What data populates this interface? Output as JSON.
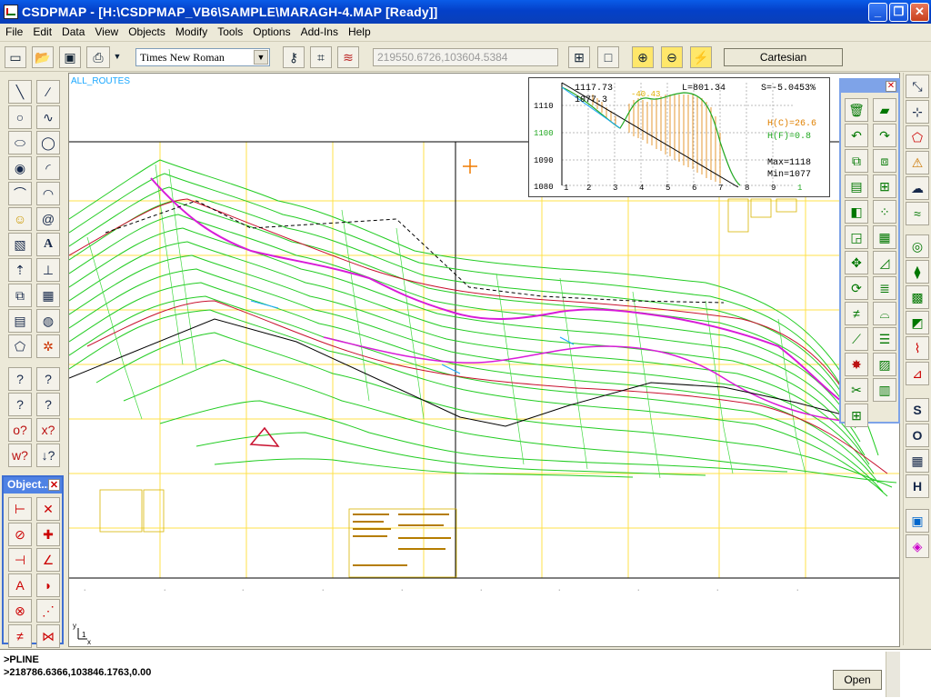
{
  "window": {
    "title": "CSDPMAP - [H:\\CSDPMAP_VB6\\SAMPLE\\MARAGH-4.MAP [Ready]]",
    "minimize": "_",
    "restore": "❐",
    "close": "✕"
  },
  "menu": [
    "File",
    "Edit",
    "Data",
    "View",
    "Objects",
    "Modify",
    "Tools",
    "Options",
    "Add-Ins",
    "Help"
  ],
  "toolbar": {
    "font_name": "Times New Roman",
    "coordinates": "219550.6726,103604.5384",
    "mode": "Cartesian"
  },
  "object_panel": {
    "title": "Object...",
    "close": "✕"
  },
  "canvas": {
    "layer_label": "ALL_ROUTES"
  },
  "profile": {
    "left_top_value": "1117.73",
    "left_second_value": "1077.3",
    "length_label": "L=801.34",
    "slope_label": "S=-5.0453%",
    "peak_label": "-40.43",
    "hc_label": "H(C)=26.6",
    "hf_label": "H(F)=0.8",
    "max_label": "Max=1118",
    "min_label": "Min=1077",
    "y_ticks": [
      "1110",
      "1100",
      "1090",
      "1080"
    ],
    "x_ticks": [
      "1",
      "2",
      "3",
      "4",
      "5",
      "6",
      "7",
      "8",
      "9",
      "1"
    ]
  },
  "right_bar_letters": [
    "S",
    "O",
    "H"
  ],
  "command": {
    "line1": ">PLINE",
    "line2": ">218786.6366,103846.1763,0.00",
    "open_button": "Open"
  },
  "colors": {
    "contour_green": "#22cc22",
    "grid_yellow": "#ffe04a",
    "route_magenta": "#d81bd8",
    "title_blue": "#0a5ce8"
  }
}
